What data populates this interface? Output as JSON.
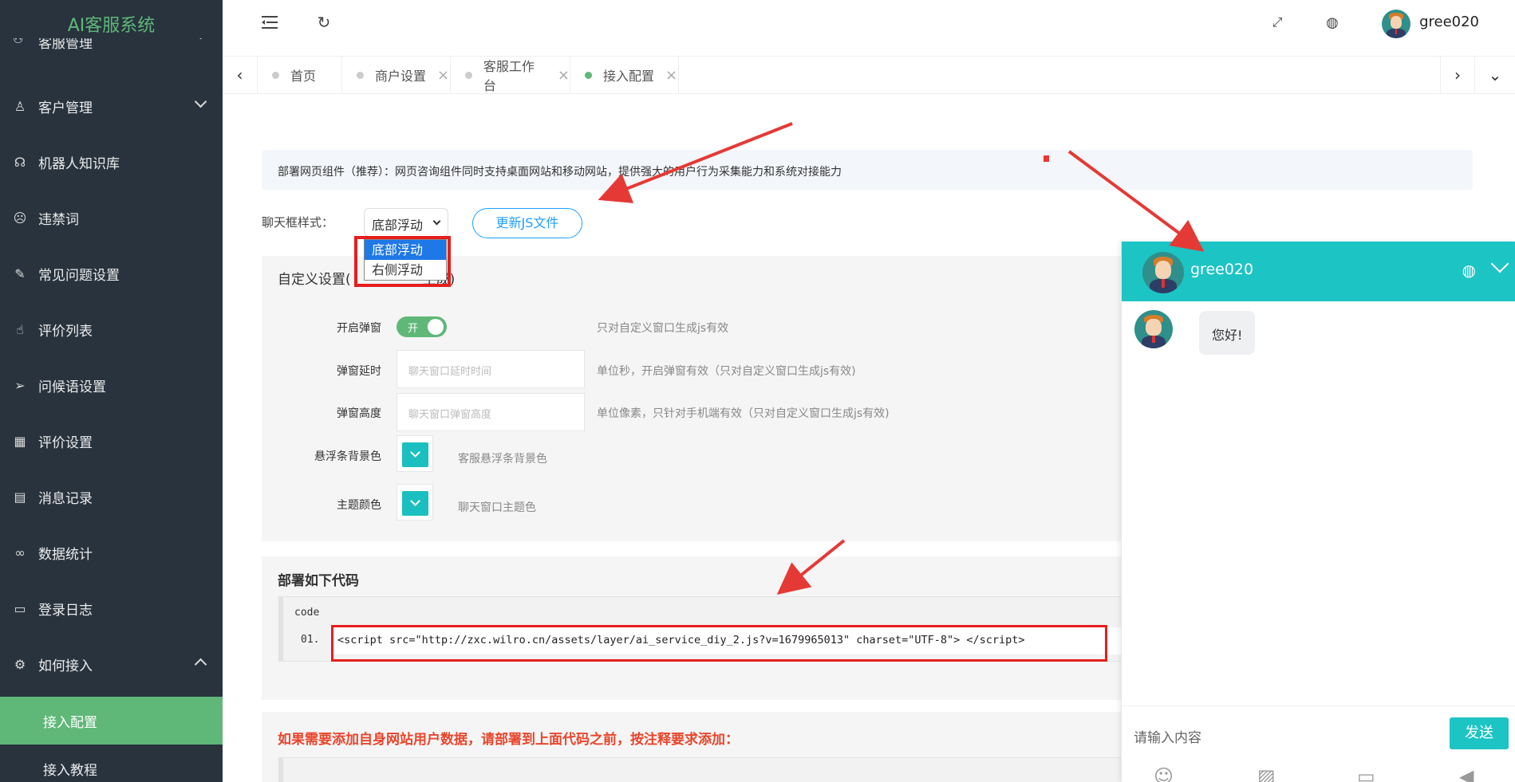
{
  "app": {
    "logo": "AI客服系统"
  },
  "sidebar": {
    "partial_item": "客服管理",
    "items": [
      {
        "label": "客户管理",
        "icon": "user-icon"
      },
      {
        "label": "机器人知识库",
        "icon": "headset-icon"
      },
      {
        "label": "违禁词",
        "icon": "emoji-icon"
      },
      {
        "label": "常见问题设置",
        "icon": "edit-icon"
      },
      {
        "label": "评价列表",
        "icon": "thumbs-up-icon"
      },
      {
        "label": "问候语设置",
        "icon": "send-icon"
      },
      {
        "label": "评价设置",
        "icon": "calendar-icon"
      },
      {
        "label": "消息记录",
        "icon": "clipboard-icon"
      },
      {
        "label": "数据统计",
        "icon": "infinity-icon"
      },
      {
        "label": "登录日志",
        "icon": "list-icon"
      },
      {
        "label": "如何接入",
        "icon": "gear-icon"
      }
    ],
    "subitems": [
      "接入配置",
      "接入教程"
    ]
  },
  "header": {
    "user_name": "gree020"
  },
  "tabs": [
    {
      "label": "首页"
    },
    {
      "label": "商户设置"
    },
    {
      "label": "客服工作台"
    },
    {
      "label": "接入配置"
    }
  ],
  "notice": "部署网页组件（推荐）：网页咨询组件同时支持桌面网站和移动网站，提供强大的用户行为采集能力和系统对接能力",
  "style_select": {
    "label": "聊天框样式：",
    "value": "底部浮动",
    "options": [
      "底部浮动",
      "右侧浮动"
    ],
    "update_button": "更新JS文件"
  },
  "custom": {
    "title_partial": "自定义设置(",
    "title_end": "生成)",
    "popup_label": "开启弹窗",
    "popup_switch": "开",
    "popup_hint": "只对自定义窗口生成js有效",
    "delay_label": "弹窗延时",
    "delay_placeholder": "聊天窗口延时时间",
    "delay_hint": "单位秒，开启弹窗有效（只对自定义窗口生成js有效)",
    "height_label": "弹窗高度",
    "height_placeholder": "聊天窗口弹窗高度",
    "height_hint": "单位像素，只针对手机端有效（只对自定义窗口生成js有效)",
    "float_bg_label": "悬浮条背景色",
    "float_bg_hint": "客服悬浮条背景色",
    "theme_label": "主题颜色",
    "theme_hint": "聊天窗口主题色",
    "color": "#1cbfbf"
  },
  "deploy": {
    "title": "部署如下代码",
    "code_label": "code",
    "line_no": "01.",
    "code": "<script src=\"http://zxc.wilro.cn/assets/layer/ai_service_diy_2.js?v=1679965013\" charset=\"UTF-8\"> </script>"
  },
  "user_data": {
    "title": "如果需要添加自身网站用户数据，请部署到上面代码之前，按注释要求添加："
  },
  "chat": {
    "title": "gree020",
    "message": "您好!",
    "input_placeholder": "请输入内容",
    "send_label": "发送",
    "header_color": "#1dc4c4"
  }
}
